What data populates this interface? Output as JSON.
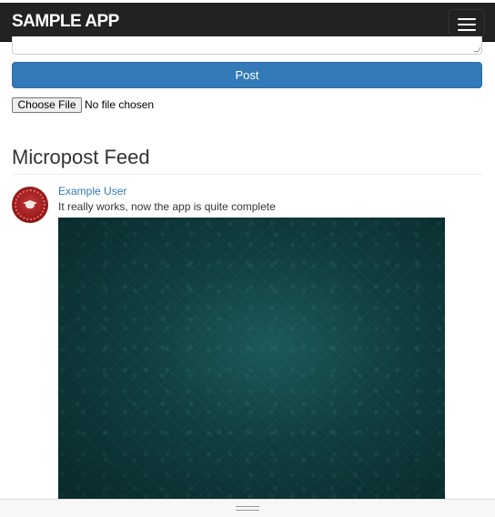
{
  "navbar": {
    "brand": "SAMPLE APP",
    "menu_icon": "hamburger-menu-icon"
  },
  "composer": {
    "post_label": "Post",
    "file_button_label": "Choose File",
    "file_status": "No file chosen"
  },
  "feed": {
    "title": "Micropost Feed",
    "items": [
      {
        "user": "Example User",
        "content": "It really works, now the app is quite complete",
        "avatar_icon": "graduation-cap-avatar-icon"
      }
    ]
  },
  "colors": {
    "navbar_bg": "#222222",
    "primary": "#337ab7",
    "link": "#337ab7",
    "image_bg": "#0f3d3e"
  }
}
